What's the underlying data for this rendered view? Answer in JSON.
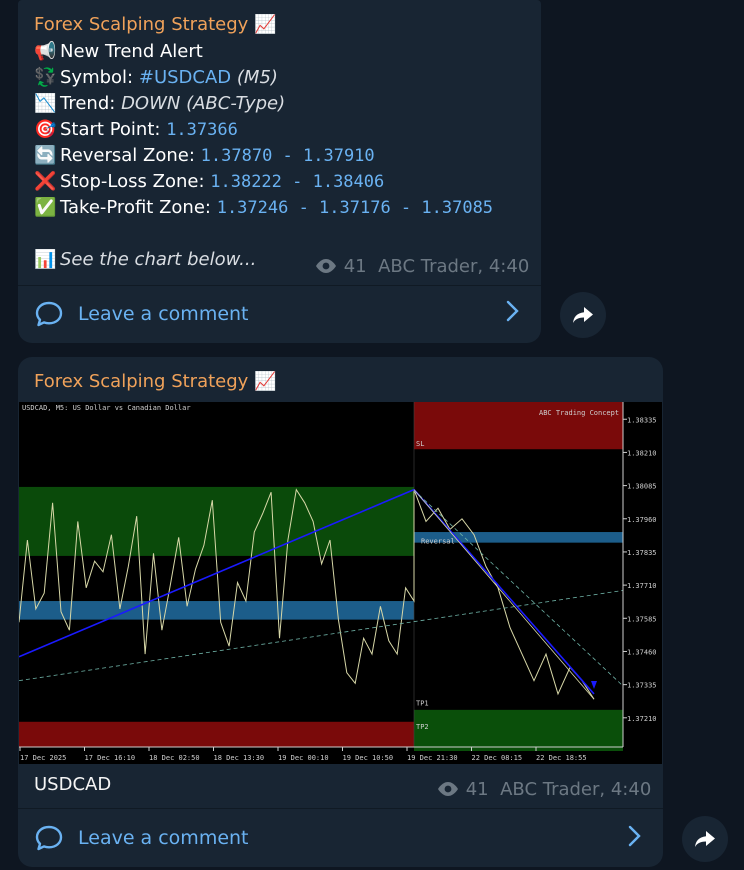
{
  "message1": {
    "channel": "Forex Scalping Strategy",
    "channel_emoji": "📈",
    "alert": {
      "emoji": "📢",
      "text": "New Trend Alert"
    },
    "symbol": {
      "emoji": "💱",
      "label": "Symbol:",
      "tag": "#USDCAD",
      "tf": "(M5)"
    },
    "trend": {
      "emoji": "📉",
      "label": "Trend:",
      "value": "DOWN (ABC-Type)"
    },
    "start": {
      "emoji": "🎯",
      "label": "Start Point:",
      "value": "1.37366"
    },
    "reversal": {
      "emoji": "🔄",
      "label": "Reversal Zone:",
      "value": "1.37870 - 1.37910"
    },
    "stoploss": {
      "emoji": "❌",
      "label": "Stop-Loss Zone:",
      "value": "1.38222 - 1.38406"
    },
    "takeprofit": {
      "emoji": "✅",
      "label": "Take-Profit Zone:",
      "value": "1.37246 - 1.37176 - 1.37085"
    },
    "see": {
      "emoji": "📊",
      "text": "See the chart below..."
    },
    "views": "41",
    "author_time": "ABC Trader, 4:40",
    "comment_label": "Leave a comment"
  },
  "message2": {
    "channel": "Forex Scalping Strategy",
    "channel_emoji": "📈",
    "caption": "USDCAD",
    "views": "41",
    "author_time": "ABC Trader, 4:40",
    "comment_label": "Leave a comment"
  },
  "chart_data": {
    "type": "line",
    "title": "USDCAD, M5:  US Dollar vs Canadian Dollar",
    "watermark": "ABC Trading Concept",
    "y_ticks": [
      "1.38335",
      "1.38210",
      "1.38085",
      "1.37960",
      "1.37835",
      "1.37710",
      "1.37585",
      "1.37460",
      "1.37335",
      "1.37210"
    ],
    "x_ticks": [
      "17 Dec 2025",
      "17 Dec 16:10",
      "18 Dec 02:50",
      "18 Dec 13:30",
      "19 Dec 00:10",
      "19 Dec 10:50",
      "19 Dec 21:30",
      "22 Dec 08:15",
      "22 Dec 18:55"
    ],
    "ylim": [
      1.371,
      1.384
    ],
    "zones": [
      {
        "name": "SL",
        "from": 1.38222,
        "to": 1.38406,
        "color": "#7a0a0a"
      },
      {
        "name": "Reversal",
        "from": 1.3787,
        "to": 1.3791,
        "color": "#1c5d8a"
      },
      {
        "name": "TP1",
        "from": 1.37246,
        "to": 1.37246,
        "color": "#ffffff"
      },
      {
        "name": "TP2",
        "from": 1.37085,
        "to": 1.37176,
        "color": "#0a4f0a"
      }
    ],
    "labels": {
      "sl": "SL",
      "reversal": "Reversal",
      "tp1": "TP1",
      "tp2": "TP2"
    },
    "series": [
      {
        "values": [
          1.3757,
          1.3788,
          1.3762,
          1.3768,
          1.3802,
          1.3761,
          1.3754,
          1.3795,
          1.377,
          1.378,
          1.3776,
          1.379,
          1.3762,
          1.3778,
          1.3797,
          1.3745,
          1.3783,
          1.3754,
          1.3771,
          1.3789,
          1.3763,
          1.3777,
          1.3786,
          1.3803,
          1.3757,
          1.3748,
          1.3772,
          1.3765,
          1.3791,
          1.3798,
          1.3806,
          1.3751,
          1.3788,
          1.3807,
          1.3802,
          1.3795,
          1.3779,
          1.3788,
          1.3758,
          1.3738,
          1.3734,
          1.3751,
          1.3745,
          1.3763,
          1.375,
          1.3745,
          1.377,
          1.3765
        ]
      }
    ],
    "colors": {
      "price": "#d8d8a8",
      "trend": "#1a1aff",
      "channel": "#6fb3a7"
    }
  }
}
